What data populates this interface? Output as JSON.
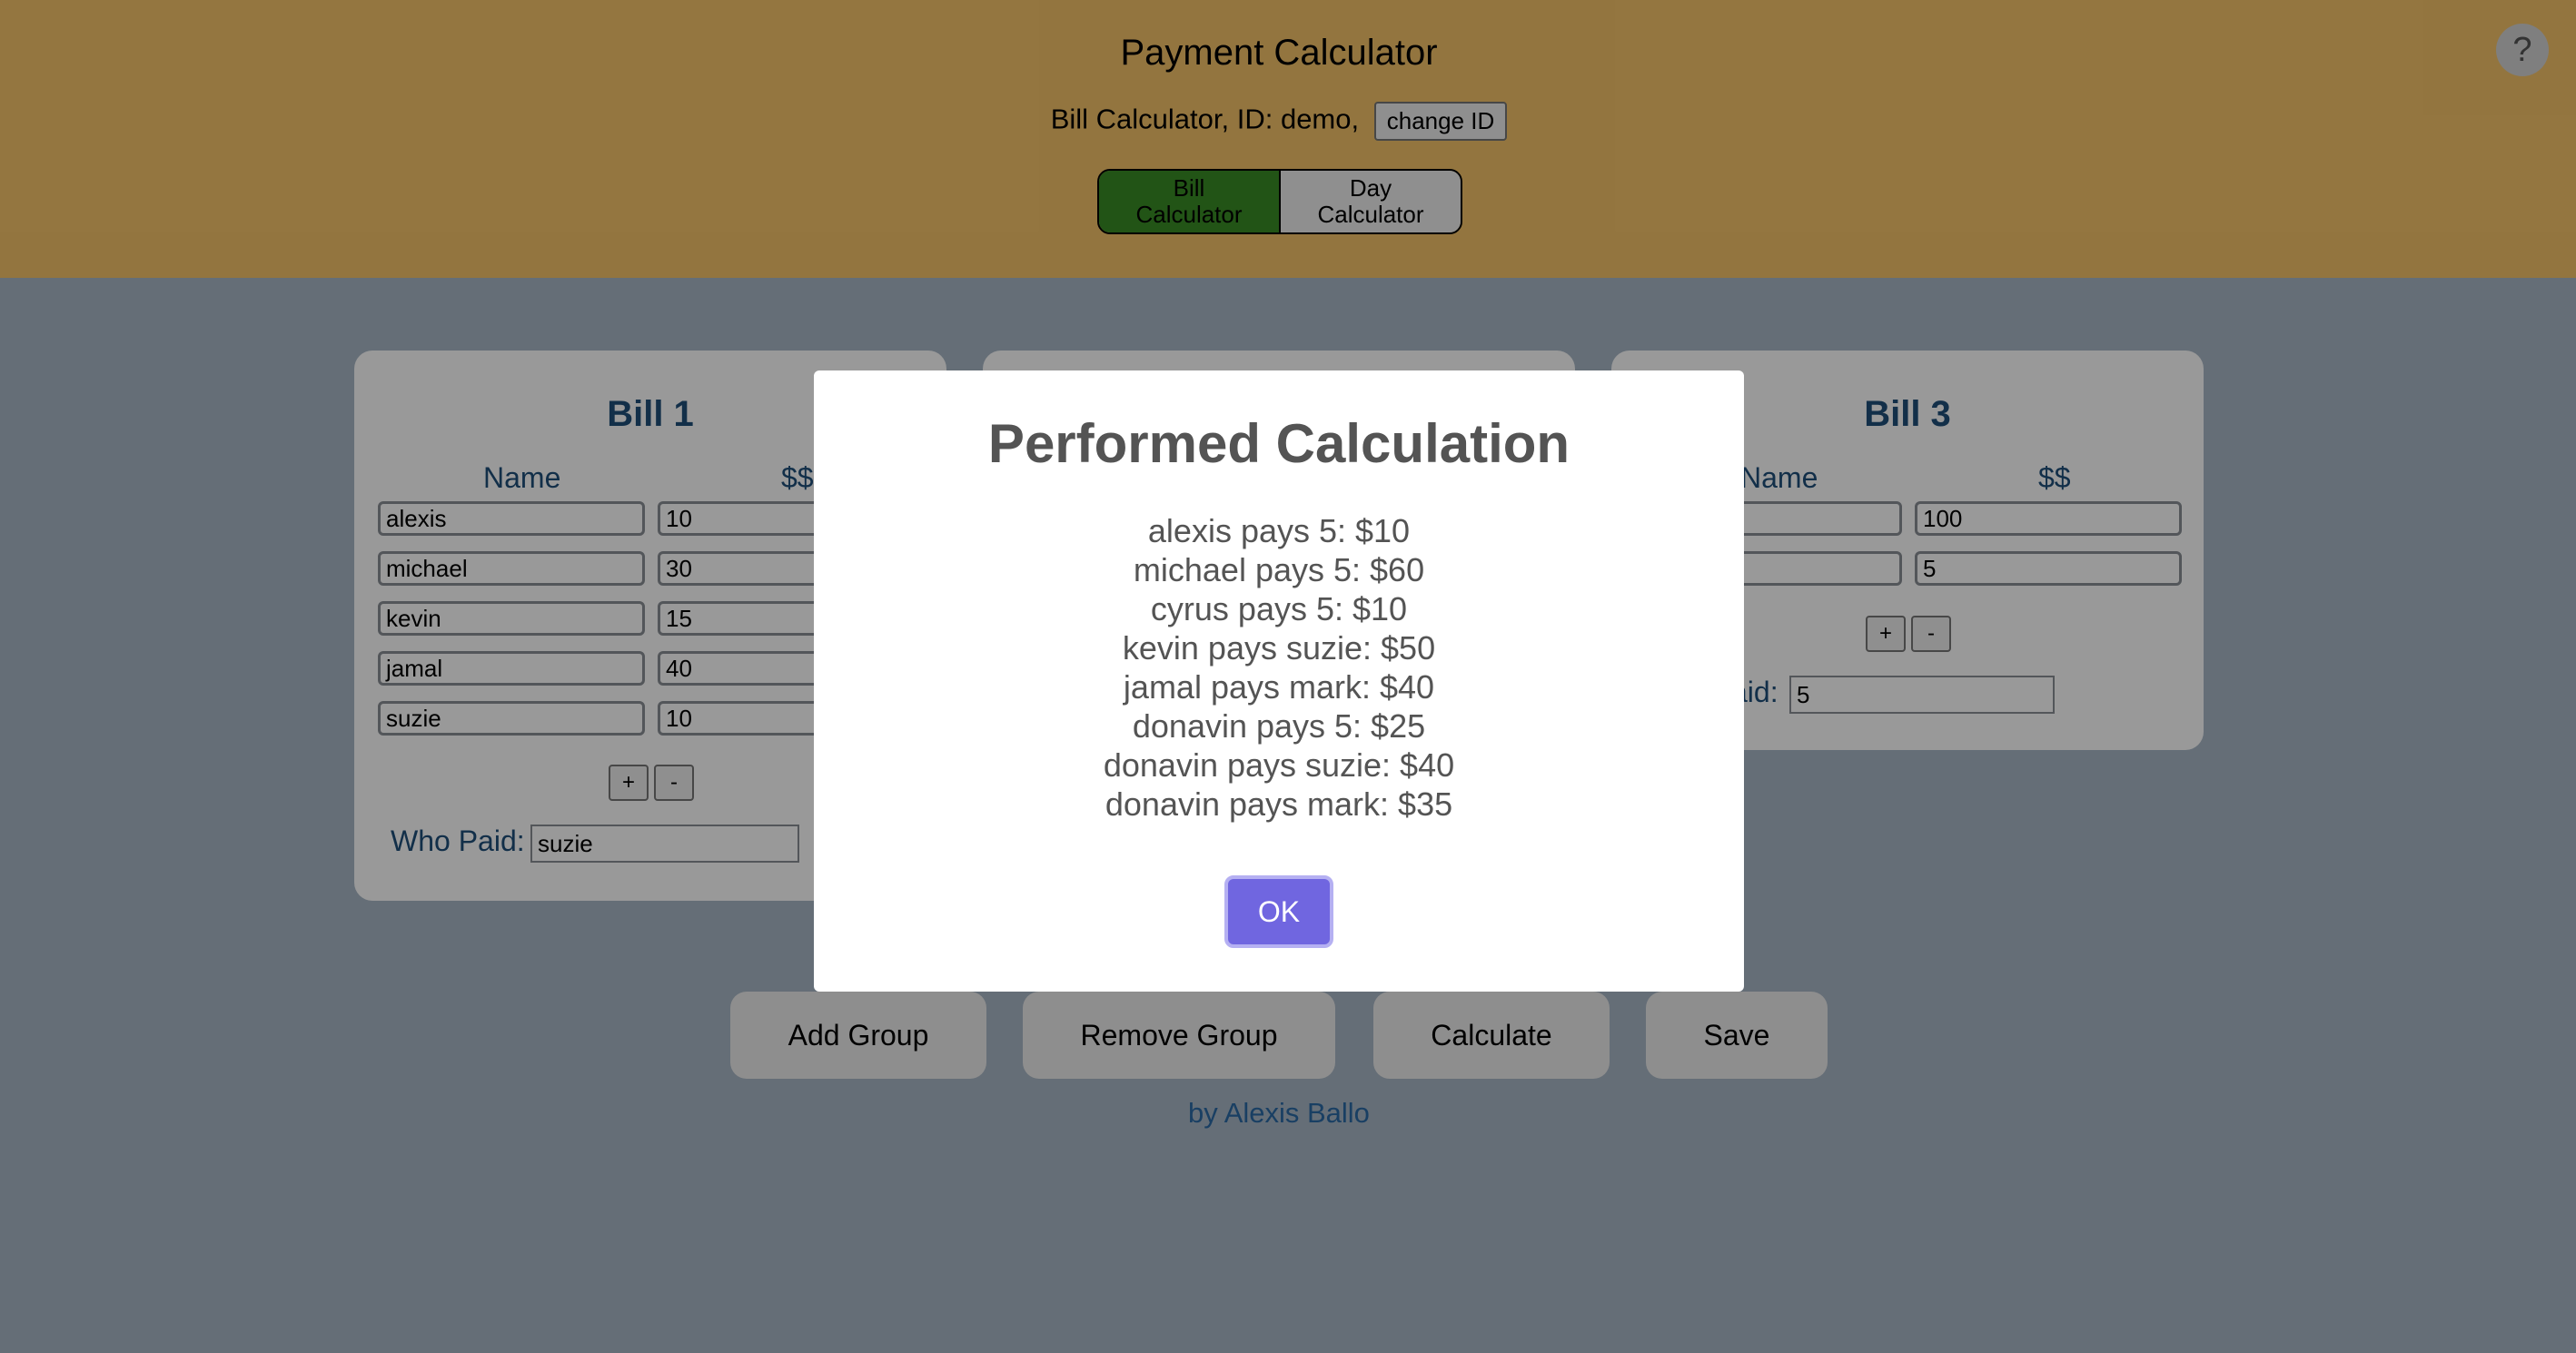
{
  "header": {
    "title": "Payment Calculator",
    "id_line": "Bill Calculator, ID: demo,",
    "change_id_label": "change ID",
    "toggle": {
      "bill": "Bill\nCalculator",
      "day": "Day\nCalculator"
    },
    "help_label": "?"
  },
  "bills": [
    {
      "title": "Bill 1",
      "name_header": "Name",
      "amount_header": "$$",
      "rows": [
        {
          "name": "alexis",
          "amount": "10"
        },
        {
          "name": "michael",
          "amount": "30"
        },
        {
          "name": "kevin",
          "amount": "15"
        },
        {
          "name": "jamal",
          "amount": "40"
        },
        {
          "name": "suzie",
          "amount": "10"
        }
      ],
      "plus": "+",
      "minus": "-",
      "who_paid_label": "Who Paid:",
      "who_paid_value": "suzie"
    },
    {
      "title": "Bill 3",
      "name_header": "Name",
      "amount_header": "$$",
      "rows": [
        {
          "name": "",
          "amount": "100"
        },
        {
          "name": "",
          "amount": "5"
        }
      ],
      "plus": "+",
      "minus": "-",
      "who_paid_label": "aid:",
      "who_paid_value": "5"
    }
  ],
  "actions": {
    "add_group": "Add Group",
    "remove_group": "Remove Group",
    "calculate": "Calculate",
    "save": "Save"
  },
  "footer": "by Alexis Ballo",
  "modal": {
    "title": "Performed Calculation",
    "results": [
      "alexis pays 5: $10",
      "michael pays 5: $60",
      "cyrus pays 5: $10",
      "kevin pays suzie: $50",
      "jamal pays mark: $40",
      "donavin pays 5: $25",
      "donavin pays suzie: $40",
      "donavin pays mark: $35"
    ],
    "ok_label": "OK"
  },
  "colors": {
    "header_bg": "#f6c46a",
    "page_bg": "#a9b8c6",
    "toggle_active": "#3a8c25",
    "ok_button": "#7066e0",
    "heading_blue": "#1f4f7a"
  }
}
